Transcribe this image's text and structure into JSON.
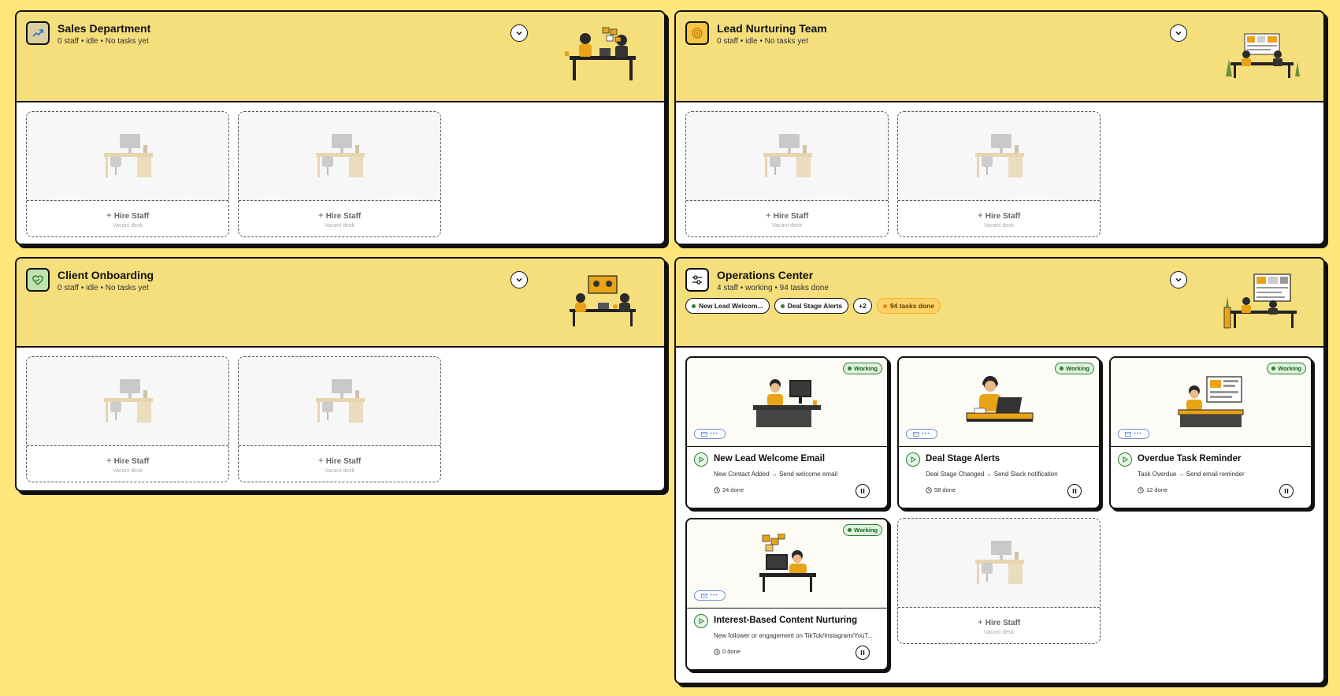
{
  "departments": [
    {
      "title": "Sales Department",
      "subtitle": "0 staff • idle • No tasks yet",
      "icon": "trend-up-icon",
      "slots": [
        {
          "hire_label": "Hire Staff",
          "vacant_label": "Vacant desk"
        },
        {
          "hire_label": "Hire Staff",
          "vacant_label": "Vacant desk"
        }
      ]
    },
    {
      "title": "Lead Nurturing Team",
      "subtitle": "0 staff • idle • No tasks yet",
      "icon": "target-icon",
      "slots": [
        {
          "hire_label": "Hire Staff",
          "vacant_label": "Vacant desk"
        },
        {
          "hire_label": "Hire Staff",
          "vacant_label": "Vacant desk"
        }
      ]
    },
    {
      "title": "Client Onboarding",
      "subtitle": "0 staff • idle • No tasks yet",
      "icon": "heart-handshake-icon",
      "slots": [
        {
          "hire_label": "Hire Staff",
          "vacant_label": "Vacant desk"
        },
        {
          "hire_label": "Hire Staff",
          "vacant_label": "Vacant desk"
        }
      ]
    },
    {
      "title": "Operations Center",
      "subtitle": "4 staff • working • 94 tasks done",
      "icon": "sliders-icon",
      "chips": [
        "New Lead Welcom...",
        "Deal Stage Alerts",
        "+2",
        "94 tasks done"
      ],
      "workers": [
        {
          "status": "Working",
          "title": "New Lead Welcome Email",
          "desc": "New Contact Added → Send welcome email",
          "done": "24 done"
        },
        {
          "status": "Working",
          "title": "Deal Stage Alerts",
          "desc": "Deal Stage Changed → Send Slack notification",
          "done": "58 done"
        },
        {
          "status": "Working",
          "title": "Overdue Task Reminder",
          "desc": "Task Overdue → Send email reminder",
          "done": "12 done"
        },
        {
          "status": "Working",
          "title": "Interest-Based Content Nurturing",
          "desc": "New follower or engagement on TikTok/Instagram/YouT...",
          "done": "0 done"
        }
      ],
      "slots": [
        {
          "hire_label": "Hire Staff",
          "vacant_label": "Vacant desk"
        }
      ]
    }
  ],
  "colors": {
    "background": "#FFE57A",
    "header": "#F5DE7C",
    "working": "#2e7d32",
    "accent": "#E8A317"
  }
}
